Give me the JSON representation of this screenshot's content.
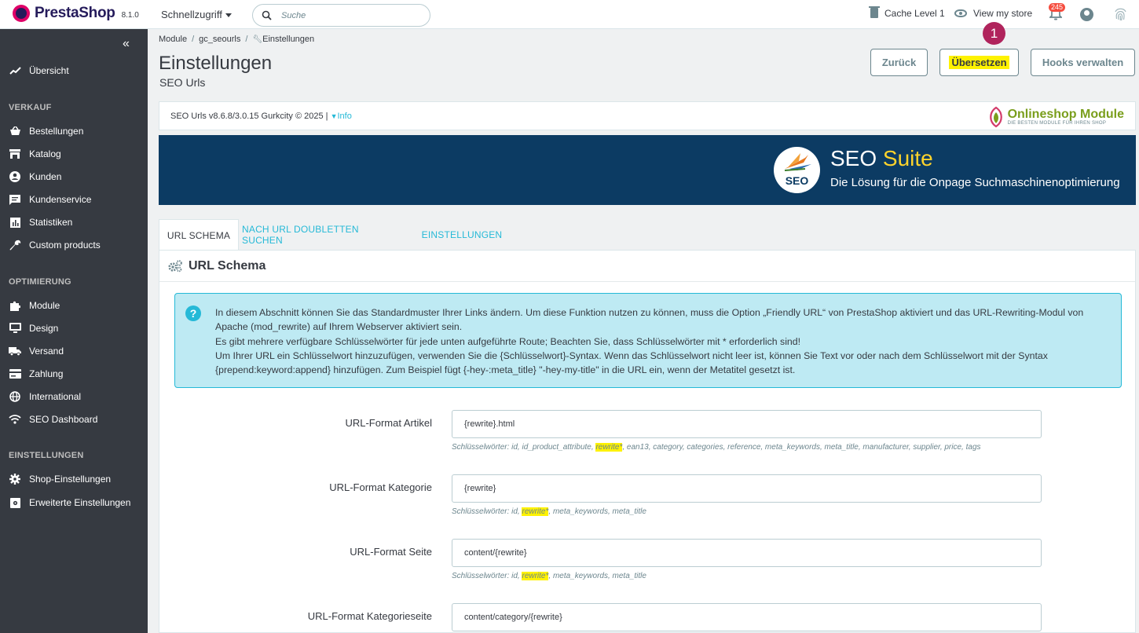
{
  "topbar": {
    "logo_text": "PrestaShop",
    "version": "8.1.0",
    "quick_access": "Schnellzugriff",
    "search_placeholder": "Suche",
    "cache_label": "Cache Level 1",
    "view_store": "View my store",
    "notifications_count": "245"
  },
  "sidebar": {
    "items": [
      {
        "label": "Übersicht",
        "icon": "trending-up-icon"
      },
      {
        "section": "VERKAUF"
      },
      {
        "label": "Bestellungen",
        "icon": "basket-icon"
      },
      {
        "label": "Katalog",
        "icon": "store-icon"
      },
      {
        "label": "Kunden",
        "icon": "user-circle-icon"
      },
      {
        "label": "Kundenservice",
        "icon": "chat-icon"
      },
      {
        "label": "Statistiken",
        "icon": "bar-chart-icon"
      },
      {
        "label": "Custom products",
        "icon": "wrench-icon"
      },
      {
        "section": "OPTIMIERUNG"
      },
      {
        "label": "Module",
        "icon": "puzzle-icon"
      },
      {
        "label": "Design",
        "icon": "monitor-icon"
      },
      {
        "label": "Versand",
        "icon": "truck-icon"
      },
      {
        "label": "Zahlung",
        "icon": "credit-card-icon"
      },
      {
        "label": "International",
        "icon": "globe-icon"
      },
      {
        "label": "SEO Dashboard",
        "icon": "wifi-icon"
      },
      {
        "section": "EINSTELLUNGEN"
      },
      {
        "label": "Shop-Einstellungen",
        "icon": "gear-icon"
      },
      {
        "label": "Erweiterte Einstellungen",
        "icon": "settings-box-icon"
      }
    ]
  },
  "breadcrumb": [
    "Module",
    "gc_seourls",
    "Einstellungen"
  ],
  "page": {
    "title": "Einstellungen",
    "subtitle": "SEO Urls"
  },
  "toolbar": {
    "back": "Zurück",
    "translate": "Übersetzen",
    "hooks": "Hooks verwalten",
    "step_badge": "1"
  },
  "module_info": {
    "text": "SEO Urls v8.6.8/3.0.15 Gurkcity © 2025 |",
    "info_link": "Info",
    "brand_title": "Onlineshop Module",
    "brand_tagline": "DIE BESTEN MODULE FÜR IHREN SHOP"
  },
  "banner": {
    "logo_text": "SEO",
    "title_main": "SEO",
    "title_accent": "Suite",
    "subtitle": "Die Lösung für die Onpage Suchmaschinenoptimierung"
  },
  "tabs": [
    "URL SCHEMA",
    "NACH URL DOUBLETTEN SUCHEN",
    "EINSTELLUNGEN"
  ],
  "panel": {
    "title": "URL Schema",
    "alert_lines": [
      "In diesem Abschnitt können Sie das Standardmuster Ihrer Links ändern. Um diese Funktion nutzen zu können, muss die Option „Friendly URL“ von PrestaShop aktiviert und das URL-Rewriting-Modul von Apache (mod_rewrite) auf Ihrem Webserver aktiviert sein.",
      "Es gibt mehrere verfügbare Schlüsselwörter für jede unten aufgeführte Route; Beachten Sie, dass Schlüsselwörter mit * erforderlich sind!",
      "Um Ihrer URL ein Schlüsselwort hinzuzufügen, verwenden Sie die {Schlüsselwort}-Syntax. Wenn das Schlüsselwort nicht leer ist, können Sie Text vor oder nach dem Schlüsselwort mit der Syntax {prepend:keyword:append} hinzufügen. Zum Beispiel fügt {-hey-:meta_title} \"-hey-my-title\" in die URL ein, wenn der Metatitel gesetzt ist."
    ],
    "fields": [
      {
        "label": "URL-Format Artikel",
        "value": "{rewrite}.html",
        "help_pre": "Schlüsselwörter: id, id_product_attribute, ",
        "help_hl": "rewrite*",
        "help_post": ", ean13, category, categories, reference, meta_keywords, meta_title, manufacturer, supplier, price, tags"
      },
      {
        "label": "URL-Format Kategorie",
        "value": "{rewrite}",
        "help_pre": "Schlüsselwörter: id, ",
        "help_hl": "rewrite*",
        "help_post": ", meta_keywords, meta_title"
      },
      {
        "label": "URL-Format Seite",
        "value": "content/{rewrite}",
        "help_pre": "Schlüsselwörter: id, ",
        "help_hl": "rewrite*",
        "help_post": ", meta_keywords, meta_title"
      },
      {
        "label": "URL-Format Kategorieseite",
        "value": "content/category/{rewrite}"
      }
    ]
  },
  "colors": {
    "sidebar": "#363a41",
    "accent": "#25b9d7",
    "banner": "#0c3b63",
    "highlight": "#fef200",
    "badge": "#b0245c"
  }
}
